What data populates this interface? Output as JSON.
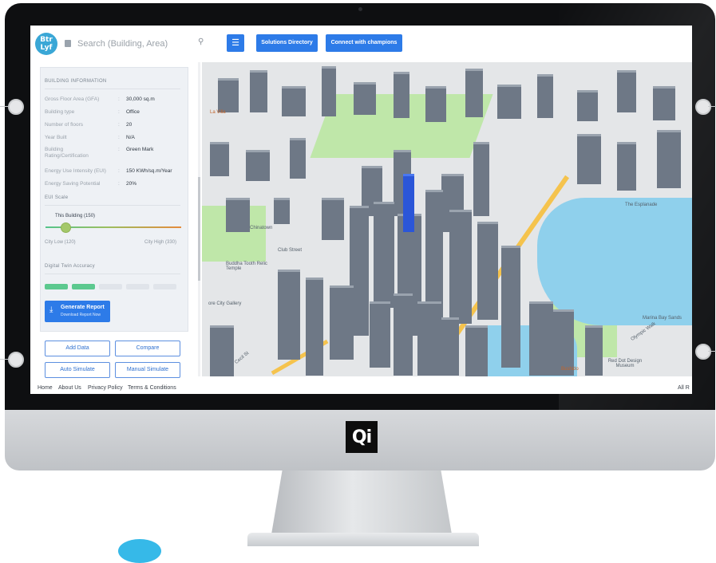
{
  "brand": {
    "logo_text": "Btr Lyf",
    "mark": "Qi"
  },
  "search": {
    "placeholder": "Search (Building, Area)"
  },
  "nav": {
    "solutions_label": "Solutions Directory",
    "champions_label": "Connect with champions"
  },
  "building_info": {
    "title": "BUILDING INFORMATION",
    "rows": [
      {
        "label": "Gross Floor Area (GFA)",
        "value": "30,000 sq.m"
      },
      {
        "label": "Building type",
        "value": "Office"
      },
      {
        "label": "Number of floors",
        "value": "20"
      },
      {
        "label": "Year Built",
        "value": "N/A"
      },
      {
        "label": "Building Rating/Certification",
        "value": "Green Mark"
      },
      {
        "label": "Energy Use Intensity (EUI)",
        "value": "150 KWh/sq.m/Year"
      },
      {
        "label": "Energy Saving Potential",
        "value": "20%"
      }
    ],
    "separator": ":"
  },
  "eui_scale": {
    "title": "EUI Scale",
    "this_building": "This Building (150)",
    "low": "City Low (120)",
    "high": "City High (330)",
    "level_fraction": 0.14
  },
  "digital_twin": {
    "title": "Digital Twin Accuracy",
    "filled_segments": 2,
    "total_segments": 5,
    "filled_color": "#5cc98f",
    "empty_color": "#e0e4ea"
  },
  "report": {
    "label": "Generate Report",
    "sublabel": "Download Report Now"
  },
  "actions": {
    "add_data": "Add Data",
    "compare": "Compare",
    "auto_simulate": "Auto Simulate",
    "manual_simulate": "Manual Simulate"
  },
  "footer": {
    "home": "Home",
    "about": "About Us",
    "privacy": "Privacy Policy",
    "terms": "Terms & Conditions",
    "rights": "All R"
  },
  "map": {
    "labels": {
      "chinatown": "Chinatown",
      "club_street": "Club Street",
      "buddha": "Buddha Tooth Relic Temple",
      "gallery": "ore City Gallery",
      "marina_bay_sands": "Marina Bay Sands",
      "red_dot": "Red Dot Design Museum",
      "bushido": "Bushido",
      "olympic_walk": "Olympic Walk",
      "cecil": "Cecil St",
      "esplanade": "The Esplanade",
      "la_villa": "La Villa"
    }
  },
  "colors": {
    "accent": "#2d7be8",
    "brand": "#3aa7d6"
  }
}
